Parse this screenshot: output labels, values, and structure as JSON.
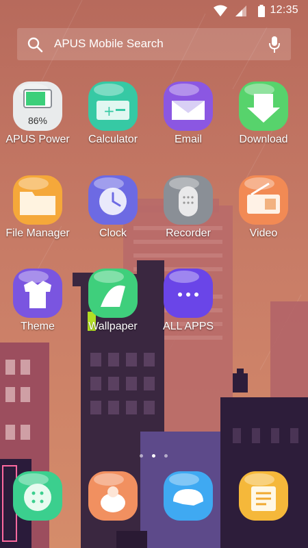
{
  "status": {
    "time": "12:35"
  },
  "search": {
    "placeholder": "APUS Mobile Search"
  },
  "apps": [
    {
      "label": "APUS Power",
      "icon": "battery-icon",
      "color": "#e9ebec",
      "badge": "86%"
    },
    {
      "label": "Calculator",
      "icon": "calculator-icon",
      "color": "#36c9a4"
    },
    {
      "label": "Email",
      "icon": "email-icon",
      "color": "#8b57e2"
    },
    {
      "label": "Download",
      "icon": "download-icon",
      "color": "#57d36c"
    },
    {
      "label": "File Manager",
      "icon": "folder-icon",
      "color": "#f5a83a"
    },
    {
      "label": "Clock",
      "icon": "clock-icon",
      "color": "#6d6ae3"
    },
    {
      "label": "Recorder",
      "icon": "recorder-icon",
      "color": "#8a8f96"
    },
    {
      "label": "Video",
      "icon": "video-icon",
      "color": "#f28a54"
    },
    {
      "label": "Theme",
      "icon": "theme-icon",
      "color": "#7a55e0"
    },
    {
      "label": "Wallpaper",
      "icon": "wallpaper-icon",
      "color": "#3fcf7c"
    },
    {
      "label": "ALL APPS",
      "icon": "all-apps-icon",
      "color": "#6a45e8"
    }
  ],
  "pager": {
    "count": 3,
    "active": 1
  },
  "dock": [
    {
      "icon": "phone-icon",
      "color": "#3bcf8e"
    },
    {
      "icon": "contacts-icon",
      "color": "#f19060"
    },
    {
      "icon": "messages-icon",
      "color": "#3fa9f2"
    },
    {
      "icon": "browser-icon",
      "color": "#f5b83a"
    }
  ]
}
